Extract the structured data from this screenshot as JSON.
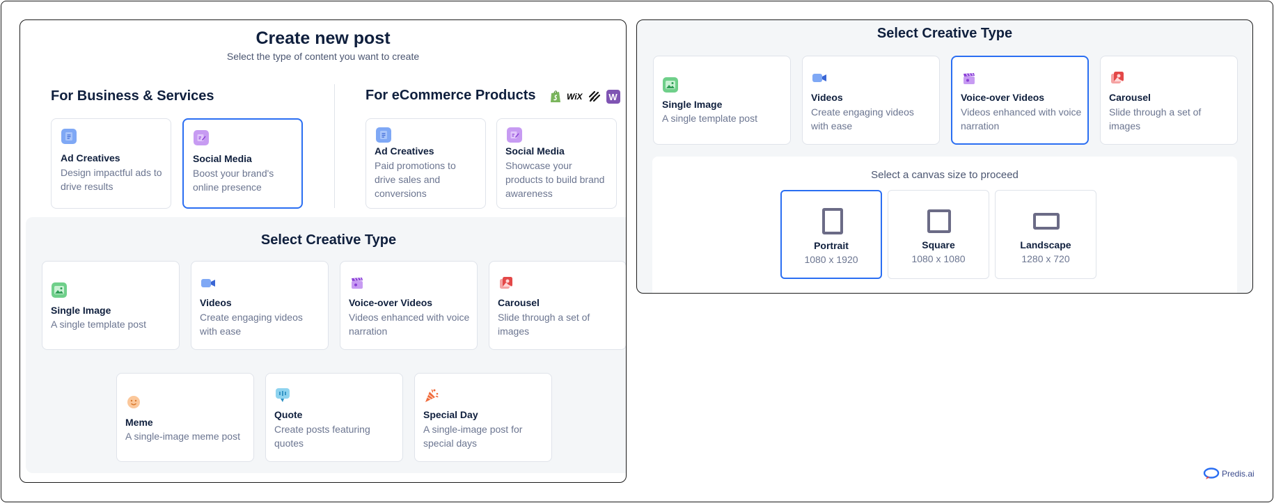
{
  "left": {
    "title": "Create new post",
    "subtitle": "Select the type of content you want to create",
    "business": {
      "heading": "For Business & Services",
      "cards": [
        {
          "title": "Ad Creatives",
          "desc": "Design impactful ads to drive results",
          "icon": "document-icon"
        },
        {
          "title": "Social Media",
          "desc": "Boost your brand's online presence",
          "icon": "edit-icon",
          "selected": true
        }
      ]
    },
    "ecommerce": {
      "heading": "For eCommerce Products",
      "brands": [
        "shopify-logo",
        "wix-logo",
        "squarespace-logo",
        "woocommerce-logo"
      ],
      "wix_text": "WiX",
      "woo_text": "W",
      "cards": [
        {
          "title": "Ad Creatives",
          "desc": "Paid promotions to drive sales and conversions",
          "icon": "document-icon"
        },
        {
          "title": "Social Media",
          "desc": "Showcase your products to build brand awareness",
          "icon": "edit-icon"
        }
      ]
    },
    "creative": {
      "heading": "Select Creative Type",
      "row1": [
        {
          "title": "Single Image",
          "desc": "A single template post",
          "icon": "image-icon"
        },
        {
          "title": "Videos",
          "desc": "Create engaging videos with ease",
          "icon": "video-camera-icon"
        },
        {
          "title": "Voice-over Videos",
          "desc": "Videos enhanced with voice narration",
          "icon": "clapperboard-icon"
        },
        {
          "title": "Carousel",
          "desc": "Slide through a set of images",
          "icon": "carousel-icon"
        }
      ],
      "row2": [
        {
          "title": "Meme",
          "desc": "A single-image meme post",
          "icon": "smiley-icon"
        },
        {
          "title": "Quote",
          "desc": "Create posts featuring quotes",
          "icon": "quote-bubble-icon"
        },
        {
          "title": "Special Day",
          "desc": "A single-image post for special days",
          "icon": "party-popper-icon"
        }
      ]
    }
  },
  "right": {
    "heading": "Select Creative Type",
    "cards": [
      {
        "title": "Single Image",
        "desc": "A single template post",
        "icon": "image-icon"
      },
      {
        "title": "Videos",
        "desc": "Create engaging videos with ease",
        "icon": "video-camera-icon"
      },
      {
        "title": "Voice-over Videos",
        "desc": "Videos enhanced with voice narration",
        "icon": "clapperboard-icon",
        "selected": true
      },
      {
        "title": "Carousel",
        "desc": "Slide through a set of images",
        "icon": "carousel-icon"
      }
    ],
    "canvas": {
      "prompt": "Select a canvas size to proceed",
      "sizes": [
        {
          "name": "Portrait",
          "dims": "1080 x 1920",
          "selected": true
        },
        {
          "name": "Square",
          "dims": "1080 x 1080"
        },
        {
          "name": "Landscape",
          "dims": "1280 x 720"
        }
      ]
    }
  },
  "footer": {
    "brand": "Predis.ai"
  },
  "colors": {
    "accent": "#2a6ef2",
    "text": "#0f1f3d",
    "muted": "#6b7590",
    "panel_bg": "#f4f6f8"
  }
}
